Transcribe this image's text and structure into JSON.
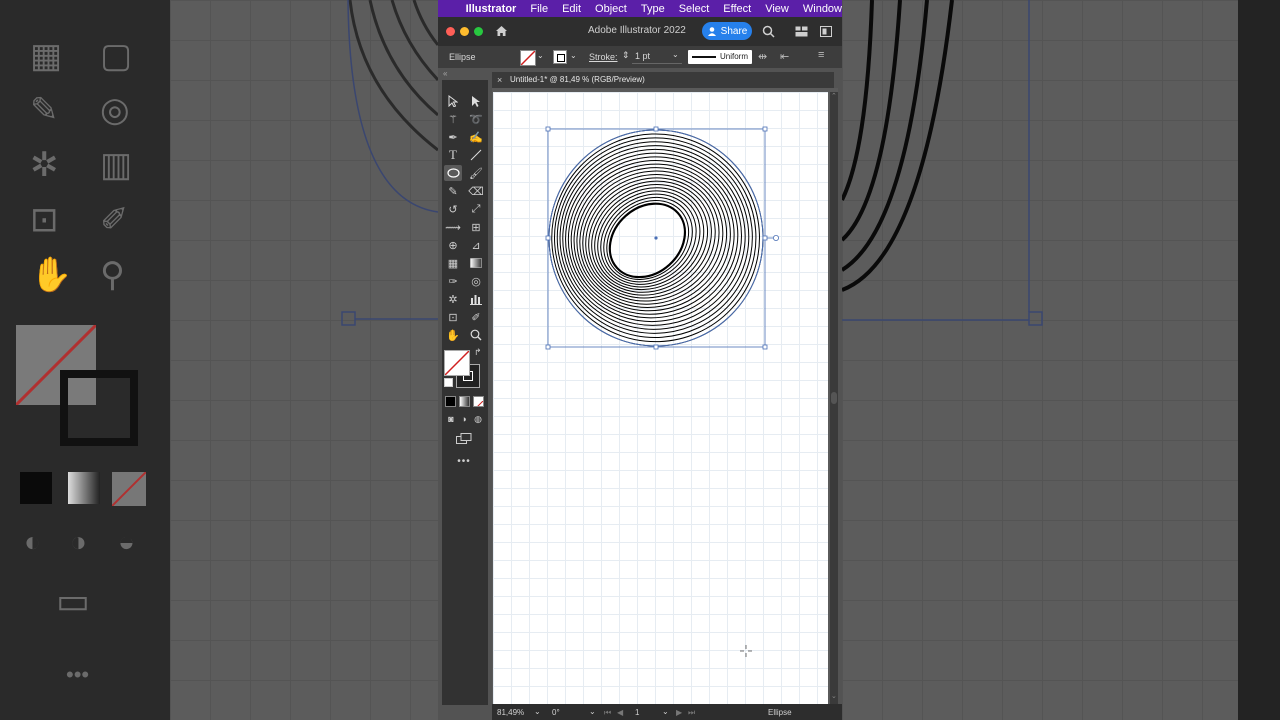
{
  "menubar": {
    "app_name": "Illustrator",
    "items": [
      "File",
      "Edit",
      "Object",
      "Type",
      "Select",
      "Effect",
      "View",
      "Window"
    ]
  },
  "titlebar": {
    "title": "Adobe Illustrator 2022",
    "share_label": "Share"
  },
  "controlbar": {
    "selection_label": "Ellipse",
    "stroke_label": "Stroke:",
    "stroke_weight": "1 pt",
    "profile_label": "Uniform"
  },
  "document": {
    "tab_title": "Untitled-1* @ 81,49 % (RGB/Preview)",
    "close_glyph": "×"
  },
  "statusbar": {
    "zoom": "81,49%",
    "rotation": "0°",
    "artboard_number": "1",
    "tool_name": "Ellipse"
  },
  "colors": {
    "menubar_bg": "#5b1fa8",
    "share_bg": "#2680eb",
    "selection_blue": "#4a6fb5"
  }
}
